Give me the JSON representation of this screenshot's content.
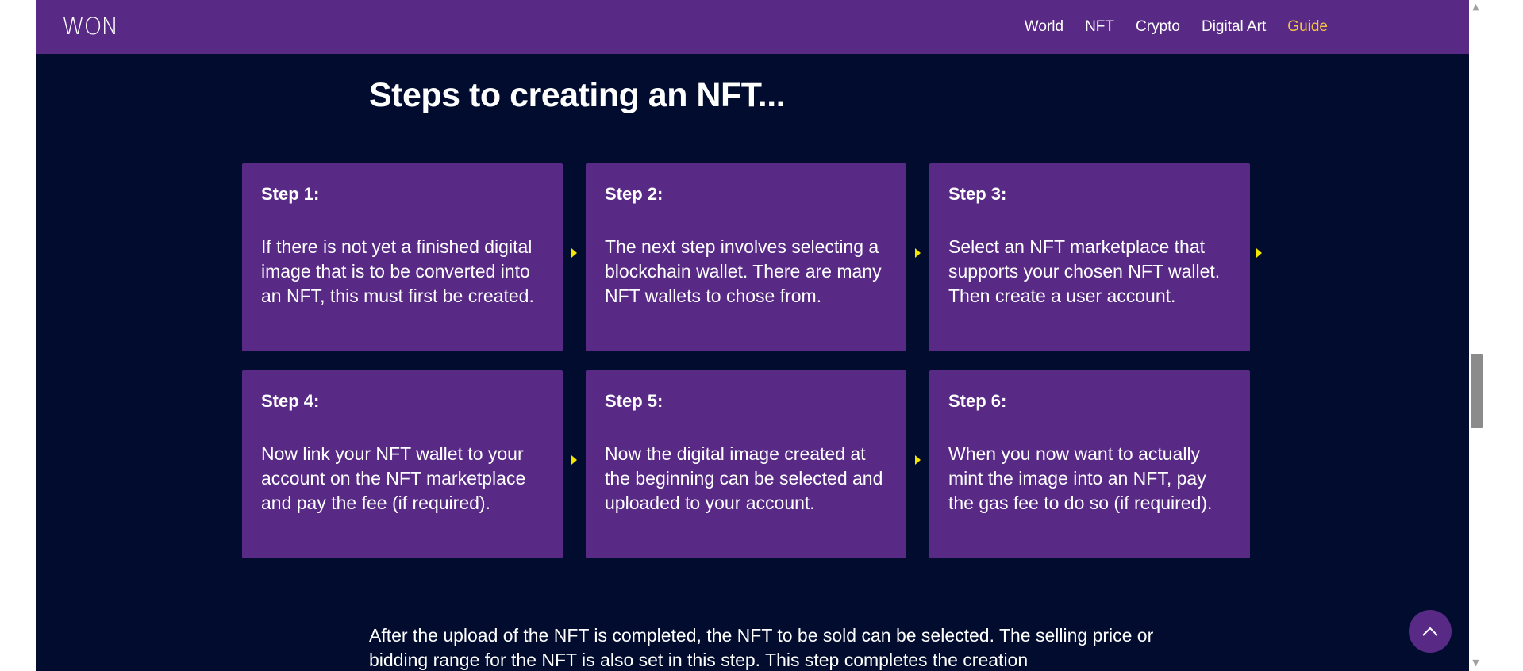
{
  "header": {
    "logo": "WON",
    "nav": [
      {
        "label": "World",
        "active": false
      },
      {
        "label": "NFT",
        "active": false
      },
      {
        "label": "Crypto",
        "active": false
      },
      {
        "label": "Digital Art",
        "active": false
      },
      {
        "label": "Guide",
        "active": true
      }
    ]
  },
  "main": {
    "heading": "Steps to creating an NFT...",
    "steps": [
      {
        "title": "Step 1:",
        "text": "If there is not yet a finished digital image that is to be converted into an NFT, this must first be created."
      },
      {
        "title": "Step 2:",
        "text": "The next step involves selecting a blockchain wallet. There are many NFT wallets to chose from."
      },
      {
        "title": "Step 3:",
        "text": "Select an NFT marketplace that supports your chosen NFT wallet. Then create a user account."
      },
      {
        "title": "Step 4:",
        "text": "Now link your NFT wallet to your account on the NFT marketplace and pay the fee (if required)."
      },
      {
        "title": "Step 5:",
        "text": "Now the digital image created at the beginning can be selected and uploaded to your account."
      },
      {
        "title": "Step 6:",
        "text": "When you now want to actually mint the image into an NFT, pay the gas fee to do so (if required)."
      }
    ],
    "paragraph": "After the upload of the NFT is completed, the NFT to be sold can be selected. The selling price or bidding range for the NFT is also set in this step. This step completes the creation"
  },
  "colors": {
    "nav_bg": "#582a86",
    "page_bg": "#010c2e",
    "card_bg": "#582a86",
    "active_link": "#f5c542",
    "arrow": "#f5e400"
  },
  "icons": {
    "scroll_top": "chevron-up-icon",
    "step_arrow": "triangle-right-icon"
  }
}
